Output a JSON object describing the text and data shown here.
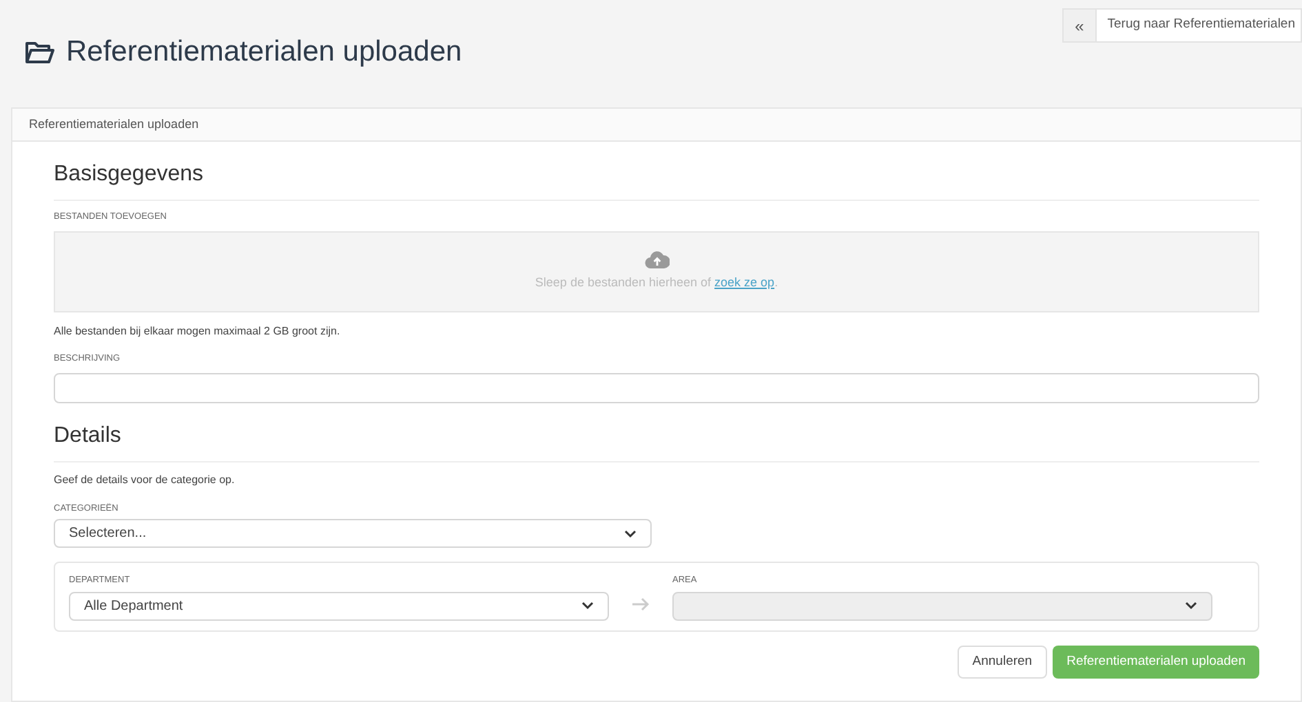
{
  "page": {
    "title": "Referentiematerialen uploaden",
    "back_button": {
      "icon": "«",
      "label": "Terug naar Referentiematerialen"
    }
  },
  "card": {
    "header": "Referentiematerialen uploaden"
  },
  "basis": {
    "heading": "Basisgegevens",
    "files_label": "BESTANDEN TOEVOEGEN",
    "drop_text": "Sleep de bestanden hierheen of ",
    "drop_link": "zoek ze op",
    "drop_end": ".",
    "size_note": "Alle bestanden bij elkaar mogen maximaal 2 GB groot zijn.",
    "description_label": "BESCHRIJVING"
  },
  "details": {
    "heading": "Details",
    "intro": "Geef de details voor de categorie op.",
    "category": {
      "label": "CATEGORIEËN",
      "value": "Selecteren..."
    },
    "department": {
      "label": "DEPARTMENT",
      "value": "Alle Department",
      "disabled": false
    },
    "area": {
      "label": "AREA",
      "disabled": true
    }
  },
  "buttons": {
    "cancel": "Annuleren",
    "submit": "Referentiematerialen uploaden"
  }
}
